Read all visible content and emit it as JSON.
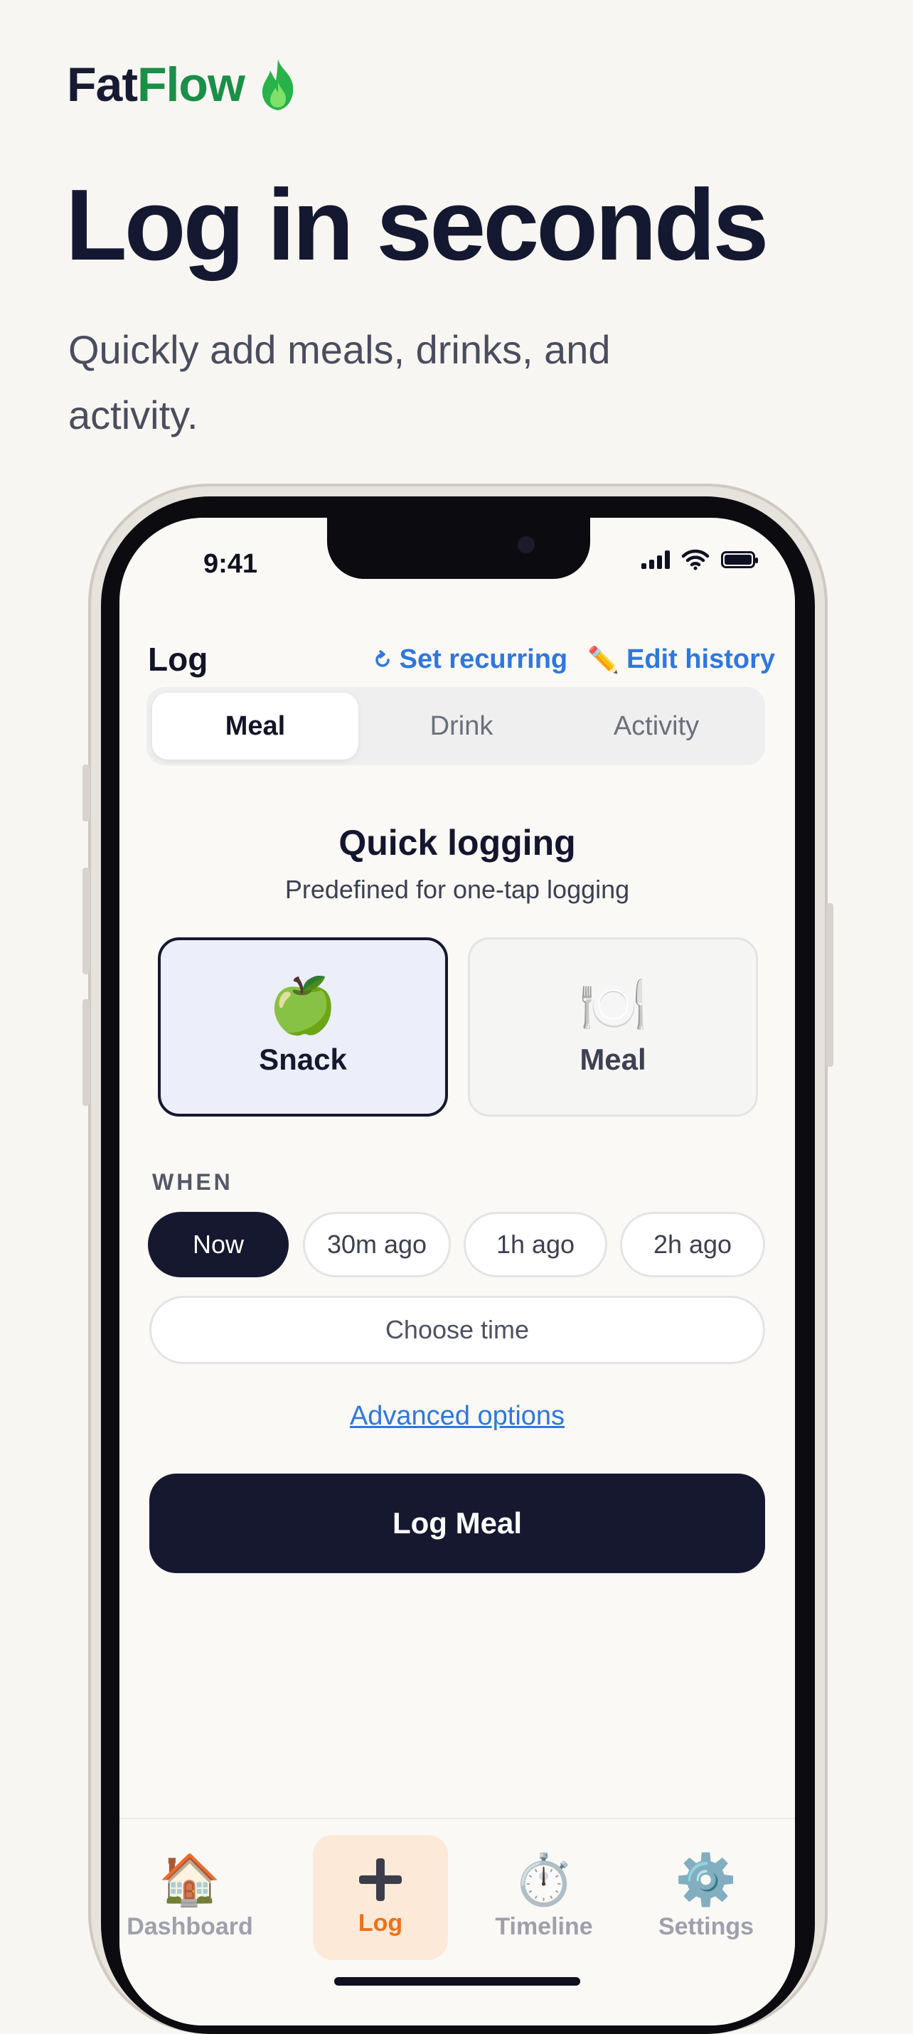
{
  "brand": {
    "part1": "Fat",
    "part2": "Flow",
    "icon": "flame-icon",
    "color_accent": "#1a8f47"
  },
  "headline": "Log in seconds",
  "subhead": "Quickly add meals, drinks, and activity.",
  "status_bar": {
    "time": "9:41"
  },
  "log_screen": {
    "title": "Log",
    "set_recurring": "Set recurring",
    "edit_history": "Edit history",
    "segments": [
      "Meal",
      "Drink",
      "Activity"
    ],
    "active_segment": "Meal",
    "quick_logging_title": "Quick logging",
    "quick_logging_subtitle": "Predefined for one-tap logging",
    "cards": [
      {
        "label": "Snack",
        "icon": "🍏",
        "selected": true
      },
      {
        "label": "Meal",
        "icon": "🍽️",
        "selected": false
      }
    ],
    "when_label": "WHEN",
    "when_options": [
      "Now",
      "30m ago",
      "1h ago",
      "2h ago"
    ],
    "when_selected": "Now",
    "choose_time": "Choose time",
    "advanced_options": "Advanced options",
    "cta": "Log Meal"
  },
  "tabbar": {
    "items": [
      {
        "label": "Dashboard",
        "icon": "🏠"
      },
      {
        "label": "Log",
        "icon": "plus-icon"
      },
      {
        "label": "Timeline",
        "icon": "⏱️"
      },
      {
        "label": "Settings",
        "icon": "⚙️"
      }
    ],
    "active": "Log",
    "active_color": "#f07018"
  }
}
